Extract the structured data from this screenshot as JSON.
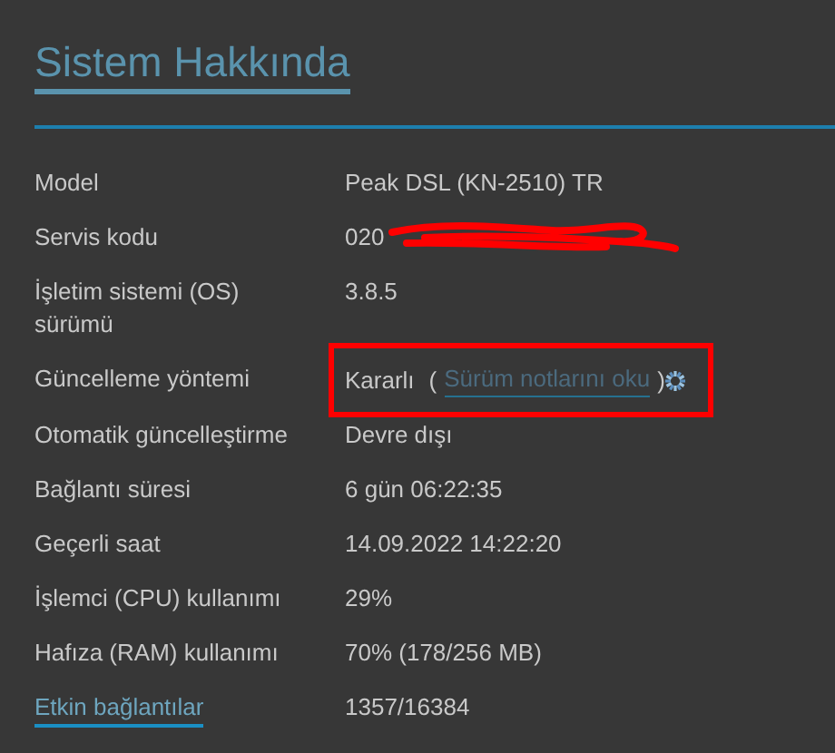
{
  "title": "Sistem Hakkında",
  "rows": [
    {
      "label": "Model",
      "label_link": false,
      "value": "Peak DSL (KN-2510) TR"
    },
    {
      "label": "Servis kodu",
      "label_link": false,
      "value": "020",
      "redacted": true
    },
    {
      "label": "İşletim sistemi (OS) sürümü",
      "label_link": false,
      "value": "3.8.5"
    },
    {
      "label": "Güncelleme yöntemi",
      "label_link": false,
      "value": "Kararlı",
      "note_open": "(",
      "note_link": "Sürüm notlarını oku",
      "note_close": ")",
      "highlighted": true
    },
    {
      "label": "Otomatik güncelleştirme",
      "label_link": false,
      "value": "Devre dışı"
    },
    {
      "label": "Bağlantı süresi",
      "label_link": false,
      "value": "6 gün 06:22:35"
    },
    {
      "label": "Geçerli saat",
      "label_link": false,
      "value": "14.09.2022 14:22:20"
    },
    {
      "label": "İşlemci (CPU) kullanımı",
      "label_link": false,
      "value": "29%"
    },
    {
      "label": "Hafıza (RAM) kullanımı",
      "label_link": false,
      "value": "70% (178/256 MB)"
    },
    {
      "label": "Etkin bağlantılar",
      "label_link": true,
      "value": "1357/16384"
    }
  ]
}
